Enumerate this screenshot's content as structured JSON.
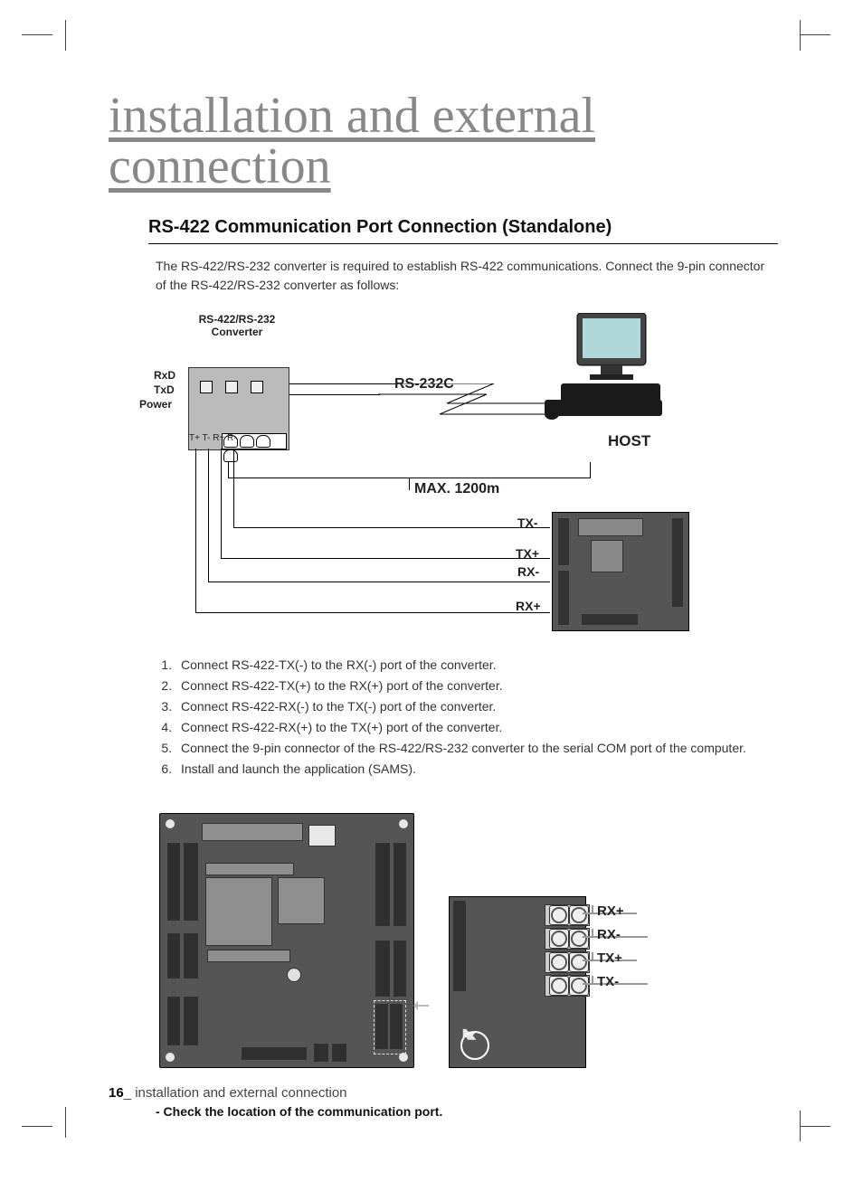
{
  "page": {
    "number": "16",
    "running_head": "installation and external connection",
    "title": "installation and external connection"
  },
  "section": {
    "heading": "RS-422 Communication Port Connection (Standalone)",
    "intro": "The RS-422/RS-232 converter is required to establish RS-422 communications. Connect the 9-pin connector of the RS-422/RS-232 converter as follows:"
  },
  "diagram1": {
    "converter_label": "RS-422/RS-232\nConverter",
    "rxd": "RxD",
    "txd": "TxD",
    "power": "Power",
    "terminals": "T+ T-  R+ R-",
    "rs232c": "RS-232C",
    "host": "HOST",
    "max_distance": "MAX. 1200m",
    "signals": {
      "tx_minus": "TX-",
      "tx_plus": "TX+",
      "rx_minus": "RX-",
      "rx_plus": "RX+"
    }
  },
  "steps": [
    "Connect RS-422-TX(-) to the RX(-) port of the converter.",
    "Connect RS-422-TX(+) to the RX(+) port of the converter.",
    "Connect RS-422-RX(-) to the TX(-) port of the converter.",
    "Connect RS-422-RX(+) to the TX(+) port of the converter.",
    "Connect the 9-pin connector of the RS-422/RS-232 converter to the serial COM port of the computer.",
    "Install and launch the application (SAMS)."
  ],
  "diagram2": {
    "rx_plus": "RX+",
    "rx_minus": "RX-",
    "tx_plus": "TX+",
    "tx_minus": "TX-"
  },
  "note": "- Check the location of the communication port."
}
